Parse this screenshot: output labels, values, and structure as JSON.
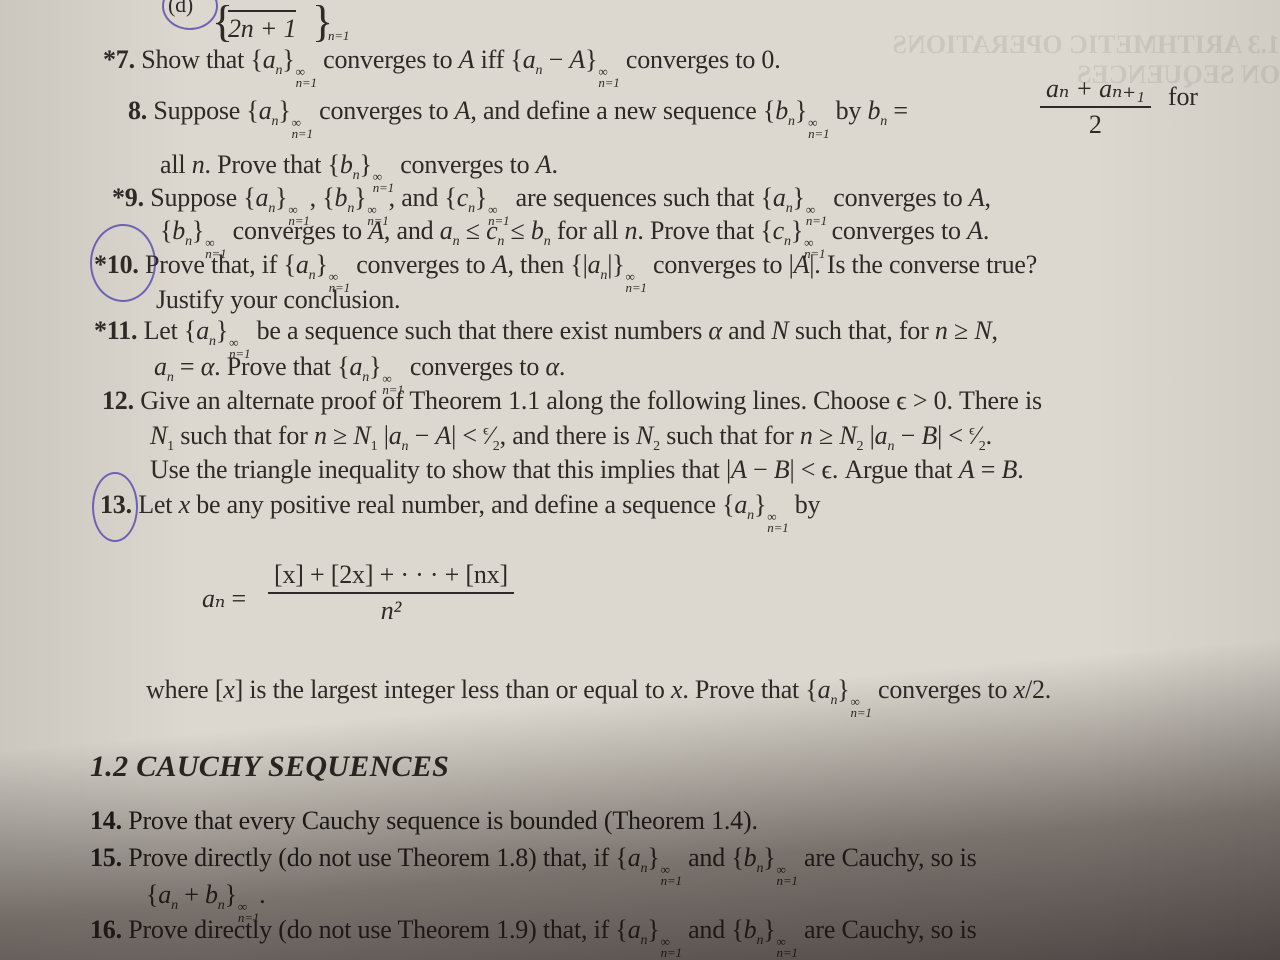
{
  "page": {
    "top_fragment": {
      "label": "(d)",
      "expr": "2n + 1",
      "subscript": "n=1"
    },
    "problems": [
      {
        "number": "*7.",
        "lines": [
          "Show that {aₙ}ₙ₌₁^∞ converges to A iff {aₙ − A}ₙ₌₁^∞ converges to 0."
        ]
      },
      {
        "number": "8.",
        "lines": [
          "Suppose {aₙ}ₙ₌₁^∞ converges to A, and define a new sequence {bₙ}ₙ₌₁^∞ by bₙ = (aₙ + aₙ₊₁)/2 for",
          "all n. Prove that {bₙ}ₙ₌₁^∞ converges to A."
        ],
        "fraction": {
          "numerator": "aₙ + aₙ₊₁",
          "denominator": "2"
        }
      },
      {
        "number": "*9.",
        "lines": [
          "Suppose {aₙ}ₙ₌₁^∞, {bₙ}ₙ₌₁^∞, and {cₙ}ₙ₌₁^∞ are sequences such that {aₙ}ₙ₌₁^∞ converges to A,",
          "{bₙ}ₙ₌₁^∞ converges to A, and aₙ ≤ cₙ ≤ bₙ for all n. Prove that {cₙ}ₙ₌₁^∞ converges to A."
        ]
      },
      {
        "number": "*10.",
        "circled": true,
        "lines": [
          "Prove that, if {aₙ}ₙ₌₁^∞ converges to A, then {|aₙ|}ₙ₌₁^∞ converges to |A|. Is the converse true?",
          "Justify your conclusion."
        ]
      },
      {
        "number": "*11.",
        "lines": [
          "Let {aₙ}ₙ₌₁^∞ be a sequence such that there exist numbers α and N such that, for n ≥ N,",
          "aₙ = α. Prove that {aₙ}ₙ₌₁^∞ converges to α."
        ]
      },
      {
        "number": "12.",
        "lines": [
          "Give an alternate proof of Theorem 1.1 along the following lines. Choose ε > 0. There is",
          "N₁ such that for n ≥ N₁ |aₙ − A| < ε/2, and there is N₂ such that for n ≥ N₂ |aₙ − B| < ε/2.",
          "Use the triangle inequality to show that this implies that |A − B| < ε. Argue that A = B."
        ]
      },
      {
        "number": "13.",
        "circled": true,
        "lines": [
          "Let x be any positive real number, and define a sequence {aₙ}ₙ₌₁^∞ by",
          "where [x] is the largest integer less than or equal to x. Prove that {aₙ}ₙ₌₁^∞ converges to x/2."
        ],
        "formula": {
          "lhs": "aₙ",
          "numerator": "[x] + [2x] + · · · + [nx]",
          "denominator": "n²"
        }
      }
    ],
    "section_heading": "1.2 CAUCHY SEQUENCES",
    "section_problems": [
      {
        "number": "14.",
        "lines": [
          "Prove that every Cauchy sequence is bounded (Theorem 1.4)."
        ]
      },
      {
        "number": "15.",
        "lines": [
          "Prove directly (do not use Theorem 1.8) that, if {aₙ}ₙ₌₁^∞ and {bₙ}ₙ₌₁^∞ are Cauchy, so is",
          "{aₙ + bₙ}ₙ₌₁^∞."
        ]
      },
      {
        "number": "16.",
        "lines": [
          "Prove directly (do not use Theorem 1.9) that, if {aₙ}ₙ₌₁^∞ and {bₙ}ₙ₌₁^∞ are Cauchy, so is"
        ]
      }
    ],
    "colors": {
      "paper": "#dcd8cf",
      "ink": "#2e2a26",
      "pen_circle": "#5a4fb0"
    }
  }
}
